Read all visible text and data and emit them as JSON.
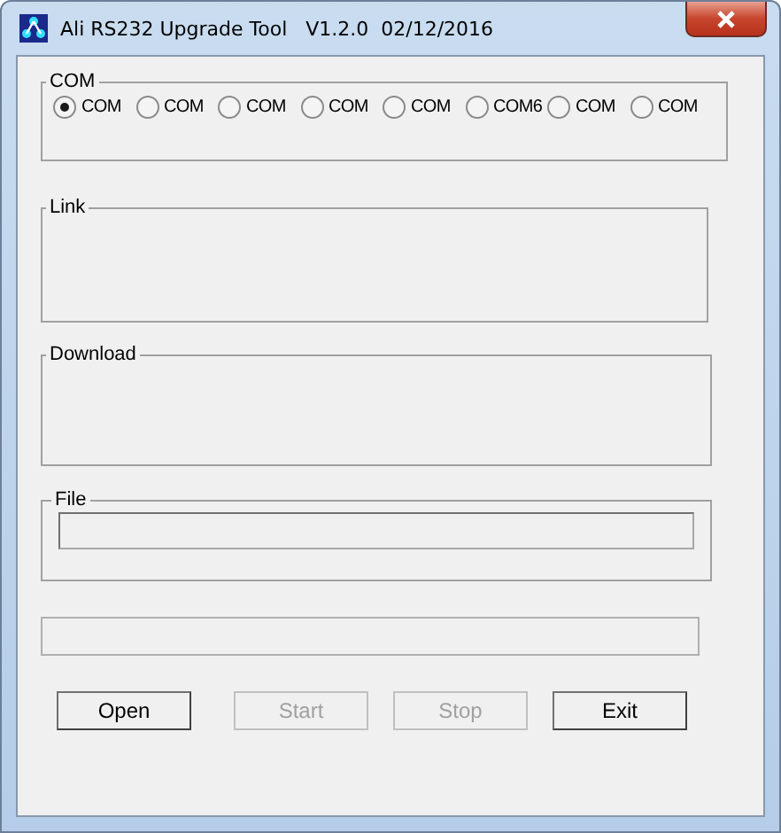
{
  "window": {
    "title": "Ali RS232 Upgrade Tool   V1.2.0  02/12/2016"
  },
  "com_group": {
    "label": "COM",
    "ports": [
      {
        "label": "COM",
        "selected": true
      },
      {
        "label": "COM",
        "selected": false
      },
      {
        "label": "COM",
        "selected": false
      },
      {
        "label": "COM",
        "selected": false
      },
      {
        "label": "COM",
        "selected": false
      },
      {
        "label": "COM6",
        "selected": false
      },
      {
        "label": "COM",
        "selected": false
      },
      {
        "label": "COM",
        "selected": false
      }
    ]
  },
  "link_group": {
    "label": "Link"
  },
  "download_group": {
    "label": "Download"
  },
  "file_group": {
    "label": "File"
  },
  "buttons": [
    {
      "label": "Open",
      "disabled": false
    },
    {
      "label": "Start",
      "disabled": true
    },
    {
      "label": "Stop",
      "disabled": true
    },
    {
      "label": "Exit",
      "disabled": false
    }
  ]
}
